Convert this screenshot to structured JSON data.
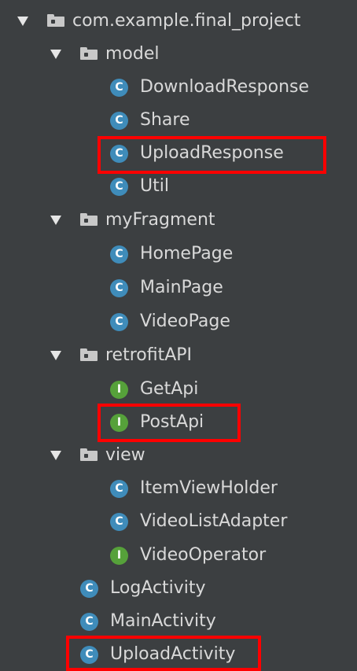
{
  "tree": {
    "package_root": {
      "label": "com.example.final_project"
    },
    "model": {
      "label": "model",
      "children": [
        {
          "label": "DownloadResponse",
          "kind_letter": "C"
        },
        {
          "label": "Share",
          "kind_letter": "C"
        },
        {
          "label": "UploadResponse",
          "kind_letter": "C"
        },
        {
          "label": "Util",
          "kind_letter": "C"
        }
      ]
    },
    "myFragment": {
      "label": "myFragment",
      "children": [
        {
          "label": "HomePage",
          "kind_letter": "C"
        },
        {
          "label": "MainPage",
          "kind_letter": "C"
        },
        {
          "label": "VideoPage",
          "kind_letter": "C"
        }
      ]
    },
    "retrofitAPI": {
      "label": "retrofitAPI",
      "children": [
        {
          "label": "GetApi",
          "kind_letter": "I"
        },
        {
          "label": "PostApi",
          "kind_letter": "I"
        }
      ]
    },
    "view": {
      "label": "view",
      "children": [
        {
          "label": "ItemViewHolder",
          "kind_letter": "C"
        },
        {
          "label": "VideoListAdapter",
          "kind_letter": "C"
        },
        {
          "label": "VideoOperator",
          "kind_letter": "I"
        }
      ]
    },
    "root_classes": [
      {
        "label": "LogActivity",
        "kind_letter": "C"
      },
      {
        "label": "MainActivity",
        "kind_letter": "C"
      },
      {
        "label": "UploadActivity",
        "kind_letter": "C"
      }
    ]
  },
  "icons": {
    "expand_arrow": "chevron-down-icon",
    "folder": "folder-icon",
    "class": "class-icon",
    "interface": "interface-icon"
  },
  "colors": {
    "panel_background": "#3c3f41",
    "text": "#d9d9d9",
    "class_badge": "#3f8cba",
    "interface_badge": "#56a13a",
    "highlight_border": "#ff0000"
  }
}
